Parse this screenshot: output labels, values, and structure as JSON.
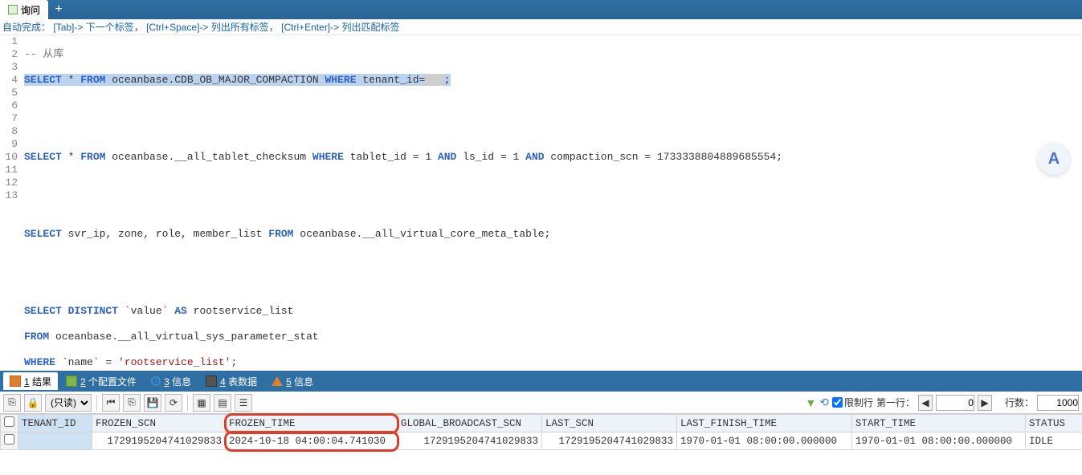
{
  "tabs": {
    "query_label": "询问",
    "add_label": "+"
  },
  "hint": {
    "prefix": "自动完成：",
    "k1": "[Tab]",
    "a1": "-> 下一个标签，",
    "k2": "[Ctrl+Space]",
    "a2": "-> 列出所有标签，",
    "k3": "[Ctrl+Enter]",
    "a3": "-> 列出匹配标签"
  },
  "editor": {
    "lines": [
      "1",
      "2",
      "3",
      "4",
      "5",
      "6",
      "7",
      "8",
      "9",
      "10",
      "11",
      "12",
      "13"
    ],
    "l1_comment": "-- 从库",
    "l2_select": "SELECT",
    "l2_star": " * ",
    "l2_from": "FROM",
    "l2_t": " oceanbase.CDB_OB_MAJOR_COMPACTION ",
    "l2_where": "WHERE",
    "l2_rest": " tenant_id=",
    "l2_redact": "   ",
    "l2_semi": ";",
    "l5": "SELECT * FROM oceanbase.__all_tablet_checksum WHERE tablet_id = 1 AND ls_id = 1 AND compaction_scn = 1733338804889685554;",
    "l5_select": "SELECT",
    "l5_from": "FROM",
    "l5_where": "WHERE",
    "l5_and": "AND",
    "l8_select": "SELECT",
    "l8_cols": " svr_ip, zone, role, member_list ",
    "l8_from": "FROM",
    "l8_t": " oceanbase.__all_virtual_core_meta_table;",
    "l11_select": "SELECT DISTINCT",
    "l11_val": " `value` ",
    "l11_as": "AS",
    "l11_alias": " rootservice_list",
    "l12_from": "FROM",
    "l12_t": " oceanbase.__all_virtual_sys_parameter_stat",
    "l13_where": "WHERE",
    "l13_rest": " `name` = ",
    "l13_str": "'rootservice_list'",
    "l13_semi": ";"
  },
  "result_tabs": {
    "t1": "1 结果",
    "t1_u": "1",
    "t2": "2 个配置文件",
    "t2_u": "2",
    "t3": "3 信息",
    "t3_u": "3",
    "t4": "4 表数据",
    "t4_u": "4",
    "t5": "5 信息",
    "t5_u": "5"
  },
  "toolbar": {
    "mode_options": [
      "(只读)"
    ],
    "limit_label": "限制行",
    "firstrow_label": "第一行：",
    "firstrow_value": "0",
    "rowcount_label": "行数：",
    "rowcount_value": "1000"
  },
  "grid": {
    "headers": {
      "tenant_id": "TENANT_ID",
      "frozen_scn": "FROZEN_SCN",
      "frozen_time": "FROZEN_TIME",
      "global_broadcast_scn": "GLOBAL_BROADCAST_SCN",
      "last_scn": "LAST_SCN",
      "last_finish_time": "LAST_FINISH_TIME",
      "start_time": "START_TIME",
      "status": "STATUS"
    },
    "rows": [
      {
        "tenant_id": "",
        "frozen_scn": "1729195204741029833",
        "frozen_time": "2024-10-18 04:00:04.741030",
        "global_broadcast_scn": "1729195204741029833",
        "last_scn": "1729195204741029833",
        "last_finish_time": "1970-01-01 08:00:00.000000",
        "start_time": "1970-01-01 08:00:00.000000",
        "status": "IDLE"
      }
    ]
  },
  "float_label": "A"
}
